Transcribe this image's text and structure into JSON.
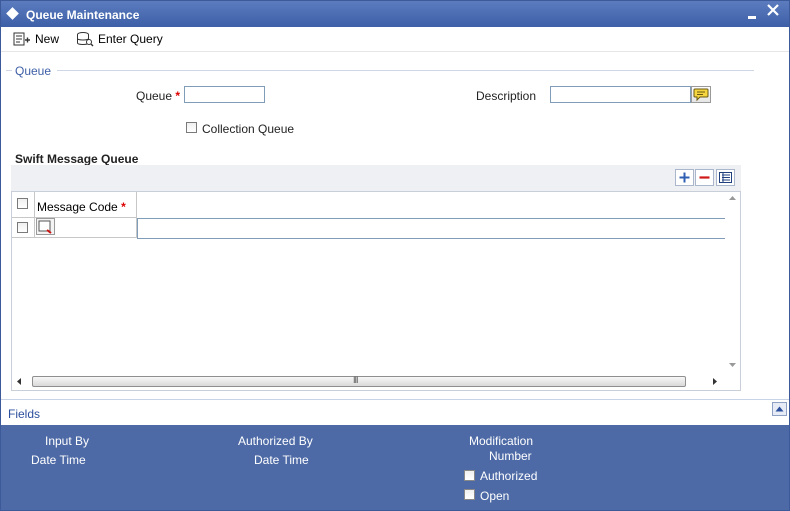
{
  "window": {
    "title": "Queue Maintenance"
  },
  "toolbar": {
    "new_label": "New",
    "enter_query_label": "Enter Query"
  },
  "queue_section": {
    "legend": "Queue",
    "queue_label": "Queue",
    "required_mark": "*",
    "queue_value": "",
    "description_label": "Description",
    "description_value": "",
    "collection_queue_label": "Collection Queue",
    "collection_queue_checked": false
  },
  "swift_section": {
    "title": "Swift Message Queue",
    "columns": [
      {
        "label": "Message Code",
        "required_mark": "*"
      }
    ],
    "rows": [
      {
        "message_code": "",
        "checked": false
      }
    ],
    "scroll_grip": "III"
  },
  "fields_bar": {
    "label": "Fields"
  },
  "audit": {
    "input_by": "Input By",
    "date_time_1": "Date Time",
    "authorized_by": "Authorized By",
    "date_time_2": "Date Time",
    "modification": "Modification",
    "number": "Number",
    "authorized_label": "Authorized",
    "open_label": "Open"
  },
  "icons": {
    "title": "diamond-icon",
    "new": "new-record-icon",
    "enter_query": "enter-query-icon",
    "lov": "list-of-values-icon",
    "add_row": "plus-icon",
    "delete_row": "minus-icon",
    "single_view": "list-view-icon"
  },
  "colors": {
    "title_bar": "#3d5fa6",
    "audit_panel": "#4d6aa6",
    "required": "#dd0000",
    "section_label": "#3e5fa6"
  }
}
